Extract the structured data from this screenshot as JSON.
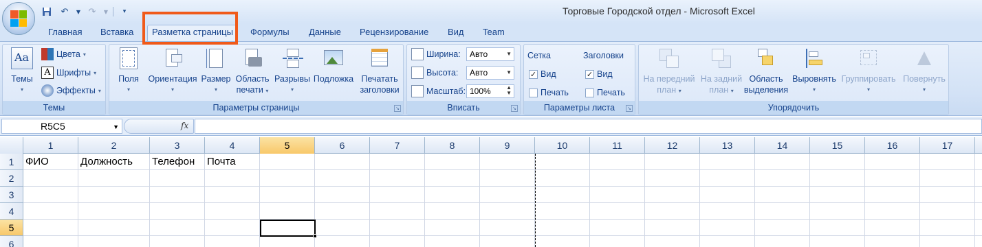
{
  "window": {
    "title": "Торговые Городской отдел - Microsoft Excel"
  },
  "tabs": [
    "Главная",
    "Вставка",
    "Разметка страницы",
    "Формулы",
    "Данные",
    "Рецензирование",
    "Вид",
    "Team"
  ],
  "active_tab": "Разметка страницы",
  "highlight_color": "#f05a1a",
  "ribbon": {
    "themes_group": {
      "label": "Темы",
      "themes_button": "Темы",
      "colors": "Цвета",
      "fonts": "Шрифты",
      "effects": "Эффекты"
    },
    "page_setup_group": {
      "label": "Параметры страницы",
      "margins": "Поля",
      "orientation": "Ориентация",
      "size": "Размер",
      "print_area_l1": "Область",
      "print_area_l2": "печати",
      "breaks": "Разрывы",
      "background": "Подложка",
      "print_titles_l1": "Печатать",
      "print_titles_l2": "заголовки"
    },
    "scale_group": {
      "label": "Вписать",
      "width_label": "Ширина:",
      "width_value": "Авто",
      "height_label": "Высота:",
      "height_value": "Авто",
      "scale_label": "Масштаб:",
      "scale_value": "100%"
    },
    "sheet_options_group": {
      "label": "Параметры листа",
      "gridlines": "Сетка",
      "headings": "Заголовки",
      "view": "Вид",
      "print": "Печать",
      "gridlines_view_checked": true,
      "gridlines_print_checked": false,
      "headings_view_checked": true,
      "headings_print_checked": false
    },
    "arrange_group": {
      "label": "Упорядочить",
      "bring_front_l1": "На передний",
      "bring_front_l2": "план",
      "send_back_l1": "На задний",
      "send_back_l2": "план",
      "selection_l1": "Область",
      "selection_l2": "выделения",
      "align": "Выровнять",
      "group": "Группировать",
      "rotate": "Повернуть"
    }
  },
  "formula_bar": {
    "name_box": "R5C5",
    "fx": "fx",
    "formula": ""
  },
  "sheet": {
    "columns": [
      "1",
      "2",
      "3",
      "4",
      "5",
      "6",
      "7",
      "8",
      "9",
      "10",
      "11",
      "12",
      "13",
      "14",
      "15",
      "16",
      "17"
    ],
    "rows": [
      "1",
      "2",
      "3",
      "4",
      "5",
      "6"
    ],
    "selected_cell": {
      "row": 5,
      "col": 5
    },
    "cells": {
      "r1c1": "ФИО",
      "r1c2": "Должность",
      "r1c3": "Телефон",
      "r1c4": "Почта"
    }
  }
}
